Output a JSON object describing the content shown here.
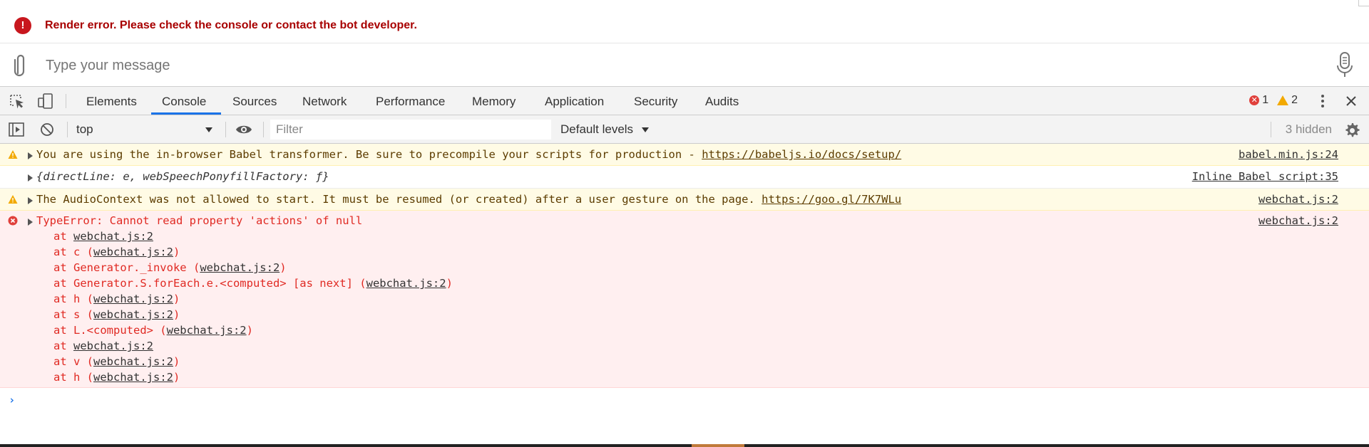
{
  "chat": {
    "error_message": "Render error. Please check the console or contact the bot developer.",
    "error_icon_glyph": "!",
    "input_placeholder": "Type your message",
    "input_value": ""
  },
  "devtools": {
    "tabs": [
      {
        "label": "Elements"
      },
      {
        "label": "Console",
        "active": true
      },
      {
        "label": "Sources"
      },
      {
        "label": "Network"
      },
      {
        "label": "Performance"
      },
      {
        "label": "Memory"
      },
      {
        "label": "Application"
      },
      {
        "label": "Security"
      },
      {
        "label": "Audits"
      }
    ],
    "error_count": "1",
    "warning_count": "2",
    "accent_color": "#1a73e8"
  },
  "console_toolbar": {
    "context": "top",
    "filter_placeholder": "Filter",
    "filter_value": "",
    "levels": "Default levels",
    "hidden": "3 hidden"
  },
  "messages": [
    {
      "type": "warning",
      "text": "You are using the in-browser Babel transformer. Be sure to precompile your scripts for production - ",
      "link": "https://babeljs.io/docs/setup/",
      "source": "babel.min.js:24"
    },
    {
      "type": "log",
      "text": "{directLine: e, webSpeechPonyfillFactory: ƒ}",
      "source": "Inline Babel script:35"
    },
    {
      "type": "warning",
      "text": "The AudioContext was not allowed to start. It must be resumed (or created) after a user gesture on the page. ",
      "link": "https://goo.gl/7K7WLu",
      "source": "webchat.js:2"
    },
    {
      "type": "error",
      "text": "TypeError: Cannot read property 'actions' of null",
      "source": "webchat.js:2",
      "stack": [
        {
          "pre": "at ",
          "link": "webchat.js:2",
          "post": ""
        },
        {
          "pre": "at c (",
          "link": "webchat.js:2",
          "post": ")"
        },
        {
          "pre": "at Generator._invoke (",
          "link": "webchat.js:2",
          "post": ")"
        },
        {
          "pre": "at Generator.S.forEach.e.<computed> [as next] (",
          "link": "webchat.js:2",
          "post": ")"
        },
        {
          "pre": "at h (",
          "link": "webchat.js:2",
          "post": ")"
        },
        {
          "pre": "at s (",
          "link": "webchat.js:2",
          "post": ")"
        },
        {
          "pre": "at L.<computed> (",
          "link": "webchat.js:2",
          "post": ")"
        },
        {
          "pre": "at ",
          "link": "webchat.js:2",
          "post": ""
        },
        {
          "pre": "at v (",
          "link": "webchat.js:2",
          "post": ")"
        },
        {
          "pre": "at h (",
          "link": "webchat.js:2",
          "post": ")"
        }
      ]
    }
  ],
  "prompt_glyph": "›"
}
